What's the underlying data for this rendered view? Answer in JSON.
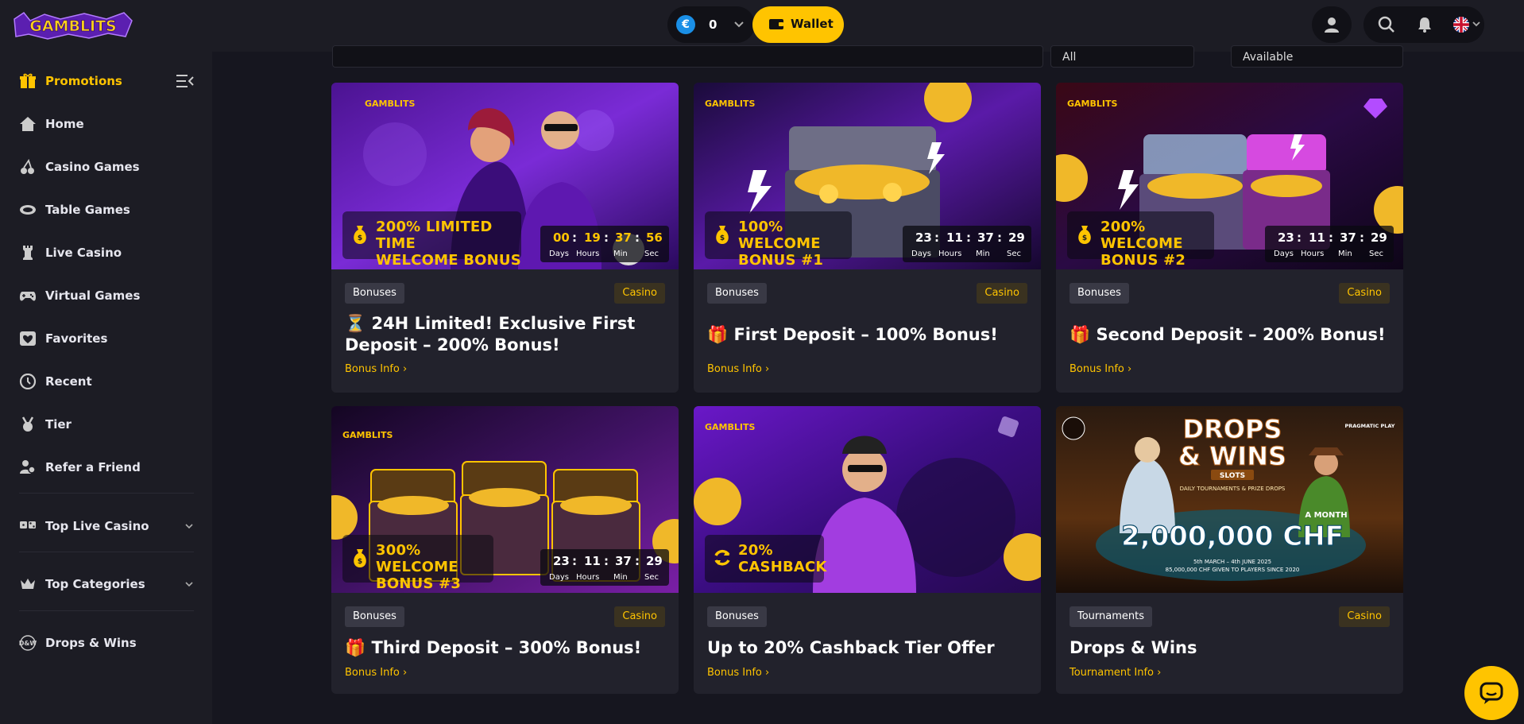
{
  "brand": {
    "logo_text": "GAMBLITS"
  },
  "header": {
    "currency_symbol": "€",
    "balance": "0",
    "wallet_label": "Wallet",
    "icons": [
      "user-icon",
      "search-icon",
      "bell-icon",
      "uk-flag-icon"
    ]
  },
  "sidebar": {
    "items": [
      {
        "label": "Promotions",
        "icon": "gift-icon",
        "active": true
      },
      {
        "label": "Home",
        "icon": "home-icon"
      },
      {
        "label": "Casino Games",
        "icon": "cherries-icon"
      },
      {
        "label": "Table Games",
        "icon": "table-icon"
      },
      {
        "label": "Live Casino",
        "icon": "chess-rook-icon"
      },
      {
        "label": "Virtual Games",
        "icon": "gamepad-icon"
      },
      {
        "label": "Favorites",
        "icon": "heart-icon"
      },
      {
        "label": "Recent",
        "icon": "clock-icon"
      },
      {
        "label": "Tier",
        "icon": "medal-icon"
      },
      {
        "label": "Refer a Friend",
        "icon": "users-icon"
      }
    ],
    "sections": [
      {
        "label": "Top Live Casino",
        "icon": "dice-icon"
      },
      {
        "label": "Top Categories",
        "icon": "crown-icon"
      }
    ],
    "footer_item": {
      "label": "Drops & Wins",
      "icon": "drops-wins-icon"
    }
  },
  "filters": {
    "category": "All",
    "status": "Available"
  },
  "timer_labels": {
    "days": "Days",
    "hours": "Hours",
    "min": "Min",
    "sec": "Sec"
  },
  "cards": [
    {
      "banner": {
        "line1": "200% LIMITED TIME",
        "line2": "WELCOME BONUS",
        "logo": "GAMBLITS"
      },
      "timer": {
        "days": "00",
        "hours": "19",
        "min": "37",
        "sec": "56"
      },
      "tag": "Bonuses",
      "badge": "Casino",
      "title": "⏳ 24H Limited! Exclusive First Deposit – 200% Bonus!",
      "link": "Bonus Info ›"
    },
    {
      "banner": {
        "line1": "100% WELCOME",
        "line2": "BONUS #1",
        "logo": "GAMBLITS"
      },
      "timer": {
        "days": "23",
        "hours": "11",
        "min": "37",
        "sec": "29"
      },
      "tag": "Bonuses",
      "badge": "Casino",
      "title": "🎁 First Deposit – 100% Bonus!",
      "link": "Bonus Info ›"
    },
    {
      "banner": {
        "line1": "200% WELCOME",
        "line2": "BONUS #2",
        "logo": "GAMBLITS"
      },
      "timer": {
        "days": "23",
        "hours": "11",
        "min": "37",
        "sec": "29"
      },
      "tag": "Bonuses",
      "badge": "Casino",
      "title": "🎁 Second Deposit – 200% Bonus!",
      "link": "Bonus Info ›"
    },
    {
      "banner": {
        "line1": "300% WELCOME",
        "line2": "BONUS #3",
        "logo": "GAMBLITS"
      },
      "timer": {
        "days": "23",
        "hours": "11",
        "min": "37",
        "sec": "29"
      },
      "tag": "Bonuses",
      "badge": "Casino",
      "title": "🎁 Third Deposit – 300% Bonus!",
      "link": "Bonus Info ›"
    },
    {
      "banner": {
        "line1": "20%",
        "line2": "CASHBACK",
        "logo": "GAMBLITS"
      },
      "tag": "Bonuses",
      "title": "Up to 20% Cashback Tier Offer",
      "link": "Bonus Info ›"
    },
    {
      "banner": {
        "line1": "DROPS",
        "line2": "& WINS",
        "sub": "SLOTS",
        "sub2": "DAILY TOURNAMENTS & PRIZE DROPS",
        "amount": "2,000,000 CHF",
        "amount_label": "A MONTH",
        "dates": "5th MARCH – 4th JUNE 2025",
        "given": "85,000,000 CHF GIVEN TO PLAYERS SINCE 2020",
        "provider": "PRAGMATIC PLAY"
      },
      "tag": "Tournaments",
      "badge": "Casino",
      "title": "Drops & Wins",
      "link": "Tournament Info ›"
    }
  ],
  "colors": {
    "accent": "#ffc400",
    "bg": "#16161f",
    "panel": "#1c1c24",
    "card": "#22222c"
  }
}
